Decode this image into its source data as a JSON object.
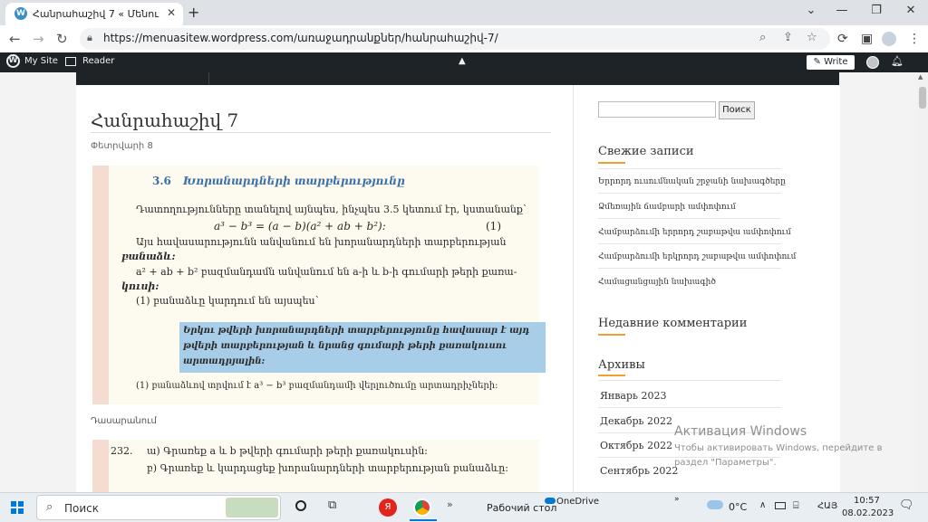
{
  "browser": {
    "tab_title": "Հանրահաշիվ 7 « Մենուա Հար",
    "url": "https://menuasitew.wordpress.com/առաջադրանքներ/հանրահաշիվ-7/",
    "icons": [
      "back-icon",
      "forward-icon",
      "reload-icon",
      "lock-icon",
      "zoom-icon",
      "share-icon",
      "star-icon",
      "extensions-icon",
      "sidepanel-icon",
      "profile-icon",
      "menu-icon"
    ]
  },
  "wpbar": {
    "my_site": "My Site",
    "reader": "Reader",
    "write": "Write"
  },
  "post": {
    "title": "Հանրահաշիվ 7",
    "date": "Փետրվարի 8",
    "caption": "Դասարանում"
  },
  "scan": {
    "heading_num": "3.6",
    "heading": "Խորանարդների տարբերությունը",
    "line1": "Դատողությունները տանելով այնպես, ինչպես 3.5 կետում էր, կստանանք՝",
    "formula": "a³ − b³ = (a − b)(a² + ab + b²):",
    "formula_num": "(1)",
    "line2": "Այս հավասարությունն անվանում են խորանարդների տարբերության",
    "line3": "բանաձև:",
    "line4": "a² + ab + b² բազմանդամն անվանում են a-ի և b-ի գումարի թերի քառա-",
    "line5": "կուսի:",
    "line6": "(1) բանաձևը կարդում են այսպես՝",
    "box1": "Երկու թվերի խորանարդների տարբերությունը հավասար է այդ",
    "box2": "թվերի տարբերության և նրանց գումարի թերի քառակուսու",
    "box3": "արտադրյալին:",
    "line7": "(1) բանաձևով տրվում է a³ − b³ բազմանդամի վերլուծումը արտադրիչների:",
    "ex_num": "232.",
    "ex_a": "ա) Գրառեք a և b թվերի գումարի թերի քառակուսին:",
    "ex_b": "բ) Գրառեք և կարդացեք խորանարդների տարբերության բանաձևը:"
  },
  "sidebar": {
    "search_button": "Поиск",
    "recent_posts_title": "Свежие записи",
    "recent_posts": [
      "Երրորդ ուսումնական շրջանի նախագծերը",
      "Ձմեռային ճամբարի ամփոփում",
      "Համբարձումի երրորդ շաբաթվա ամփոփում",
      "Համբարձումի երկրորդ շաբաթվա ամփոփում",
      "Համացանցային նախագիծ"
    ],
    "recent_comments_title": "Недавние комментарии",
    "archives_title": "Архивы",
    "archives": [
      "Январь 2023",
      "Декабрь 2022",
      "Октябрь 2022",
      "Сентябрь 2022"
    ]
  },
  "watermark": {
    "title": "Активация Windows",
    "line1": "Чтобы активировать Windows, перейдите в",
    "line2": "раздел \"Параметры\"."
  },
  "taskbar": {
    "search": "Поиск",
    "desktop": "Рабочий стол",
    "onedrive": "OneDrive",
    "temp": "0°C",
    "lang": "ՀԱՅ",
    "time": "10:57",
    "date": "08.02.2023"
  },
  "colors": {
    "wp_bar": "#1d2327",
    "accent": "#f0a030",
    "scan_highlight": "#a8cde8"
  }
}
